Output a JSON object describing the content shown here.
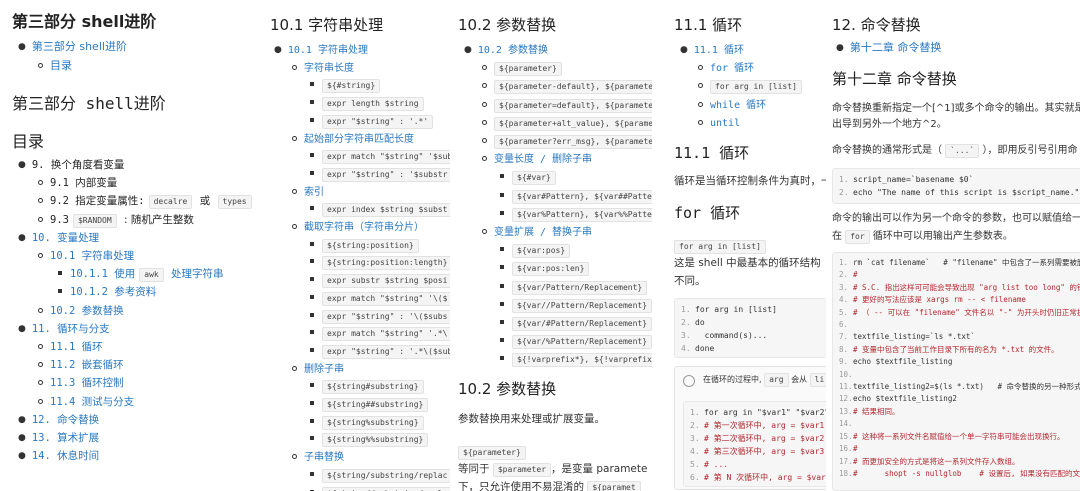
{
  "panel1": {
    "title": "第三部分 shell进阶",
    "toc1": "第三部分 shell进阶",
    "toc1_sub": "目录",
    "heading": "第三部分 shell进阶",
    "toc_title": "目录",
    "items": [
      {
        "t": "9. 换个角度看变量",
        "lv": 0,
        "link": false
      },
      {
        "t": "9.1 内部变量",
        "lv": 1,
        "link": false
      },
      {
        "t": "9.2 指定变量属性:",
        "lv": 1,
        "link": false,
        "codes": [
          "decalre",
          "或",
          "types"
        ]
      },
      {
        "t": "9.3",
        "lv": 1,
        "link": false,
        "codes": [
          "$RANDOM",
          ": 随机产生整数"
        ]
      },
      {
        "t": "10. 变量处理",
        "lv": 0,
        "link": true
      },
      {
        "t": "10.1 字符串处理",
        "lv": 1,
        "link": true
      },
      {
        "t": "10.1.1 使用",
        "lv": 2,
        "link": true,
        "codes": [
          "awk",
          "处理字符串"
        ]
      },
      {
        "t": "10.1.2 参考资料",
        "lv": 2,
        "link": true
      },
      {
        "t": "10.2 参数替换",
        "lv": 1,
        "link": true
      },
      {
        "t": "11. 循环与分支",
        "lv": 0,
        "link": true
      },
      {
        "t": "11.1 循环",
        "lv": 1,
        "link": true
      },
      {
        "t": "11.2 嵌套循环",
        "lv": 1,
        "link": true
      },
      {
        "t": "11.3 循环控制",
        "lv": 1,
        "link": true
      },
      {
        "t": "11.4 测试与分支",
        "lv": 1,
        "link": true
      },
      {
        "t": "12. 命令替换",
        "lv": 0,
        "link": true
      },
      {
        "t": "13. 算术扩展",
        "lv": 0,
        "link": true
      },
      {
        "t": "14. 休息时间",
        "lv": 0,
        "link": true
      }
    ]
  },
  "panel2": {
    "title": "10.1 字符串处理",
    "items": [
      {
        "t": "10.1 字符串处理",
        "lv": 0,
        "kind": "link"
      },
      {
        "t": "字符串长度",
        "lv": 1,
        "kind": "link"
      },
      {
        "t": "${#string}",
        "lv": 2,
        "kind": "code"
      },
      {
        "t": "expr length $string",
        "lv": 2,
        "kind": "code"
      },
      {
        "t": "expr \"$string\" : '.*'",
        "lv": 2,
        "kind": "code"
      },
      {
        "t": "起始部分字符串匹配长度",
        "lv": 1,
        "kind": "link"
      },
      {
        "t": "expr match \"$string\" '$sub",
        "lv": 2,
        "kind": "code"
      },
      {
        "t": "expr \"$string\" : '$substr",
        "lv": 2,
        "kind": "code"
      },
      {
        "t": "索引",
        "lv": 1,
        "kind": "link"
      },
      {
        "t": "expr index $string $subst",
        "lv": 2,
        "kind": "code"
      },
      {
        "t": "截取字符串（字符串分片）",
        "lv": 1,
        "kind": "link"
      },
      {
        "t": "${string:position}",
        "lv": 2,
        "kind": "code"
      },
      {
        "t": "${string:position:length}",
        "lv": 2,
        "kind": "code"
      },
      {
        "t": "expr substr $string $posi",
        "lv": 2,
        "kind": "code"
      },
      {
        "t": "expr match \"$string\" '\\($",
        "lv": 2,
        "kind": "code"
      },
      {
        "t": "expr \"$string\" : '\\($subs",
        "lv": 2,
        "kind": "code"
      },
      {
        "t": "expr match \"$string\" '.*\\",
        "lv": 2,
        "kind": "code"
      },
      {
        "t": "expr \"$string\" : '.*\\($sub",
        "lv": 2,
        "kind": "code"
      },
      {
        "t": "删除子串",
        "lv": 1,
        "kind": "link"
      },
      {
        "t": "${string#substring}",
        "lv": 2,
        "kind": "code"
      },
      {
        "t": "${string##substring}",
        "lv": 2,
        "kind": "code"
      },
      {
        "t": "${string%substring}",
        "lv": 2,
        "kind": "code"
      },
      {
        "t": "${string%%substring}",
        "lv": 2,
        "kind": "code"
      },
      {
        "t": "子串替换",
        "lv": 1,
        "kind": "link"
      },
      {
        "t": "${string/substring/replac",
        "lv": 2,
        "kind": "code"
      },
      {
        "t": "${string//substring/repla",
        "lv": 2,
        "kind": "code"
      }
    ]
  },
  "panel3": {
    "title": "10.2 参数替换",
    "items": [
      {
        "t": "10.2 参数替换",
        "lv": 0,
        "kind": "link"
      },
      {
        "t": "${parameter}",
        "lv": 1,
        "kind": "code"
      },
      {
        "t": "${parameter-default}, ${parameter",
        "lv": 1,
        "kind": "code"
      },
      {
        "t": "${parameter=default}, ${parameter",
        "lv": 1,
        "kind": "code"
      },
      {
        "t": "${parameter+alt_value}, ${paramet",
        "lv": 1,
        "kind": "code"
      },
      {
        "t": "${parameter?err_msg}, ${parameter",
        "lv": 1,
        "kind": "code"
      },
      {
        "t": "变量长度 / 删除子串",
        "lv": 1,
        "kind": "link"
      },
      {
        "t": "${#var}",
        "lv": 2,
        "kind": "code"
      },
      {
        "t": "${var#Pattern}, ${var##Patter",
        "lv": 2,
        "kind": "code"
      },
      {
        "t": "${var%Pattern}, ${var%%Patter",
        "lv": 2,
        "kind": "code"
      },
      {
        "t": "变量扩展 / 替换子串",
        "lv": 1,
        "kind": "link"
      },
      {
        "t": "${var:pos}",
        "lv": 2,
        "kind": "code"
      },
      {
        "t": "${var:pos:len}",
        "lv": 2,
        "kind": "code"
      },
      {
        "t": "${var/Pattern/Replacement}",
        "lv": 2,
        "kind": "code"
      },
      {
        "t": "${var//Pattern/Replacement}",
        "lv": 2,
        "kind": "code"
      },
      {
        "t": "${var/#Pattern/Replacement}",
        "lv": 2,
        "kind": "code"
      },
      {
        "t": "${var/%Pattern/Replacement}",
        "lv": 2,
        "kind": "code"
      },
      {
        "t": "${!varprefix*}, ${!varprefix",
        "lv": 2,
        "kind": "code"
      }
    ],
    "section": "10.2 参数替换",
    "para1": "参数替换用来处理或扩展变量。",
    "code1": "${parameter}",
    "para2a": "等同于",
    "para2code": "$parameter",
    "para2b": "，是变量 paramete",
    "para3a": "下，只允许使用不易混淆的",
    "para3code": "${paramet"
  },
  "panel4": {
    "title": "11.1 循环",
    "items": [
      {
        "t": "11.1 循环",
        "lv": 0,
        "kind": "link"
      },
      {
        "t": "for 循环",
        "lv": 1,
        "kind": "link"
      },
      {
        "t": "for arg in [list]",
        "lv": 1,
        "kind": "code"
      },
      {
        "t": "while 循环",
        "lv": 1,
        "kind": "link"
      },
      {
        "t": "until",
        "lv": 1,
        "kind": "link"
      }
    ],
    "section": "11.1 循环",
    "para1": "循环是当循环控制条件为真时，一",
    "sub": "for 循环",
    "code1": "for arg in [list]",
    "para2": "这是 shell 中最基本的循环结构",
    "para3": "不同。",
    "code_lines": [
      {
        "n": "1.",
        "t": "for arg in [list]"
      },
      {
        "n": "2.",
        "t": "do"
      },
      {
        "n": "3.",
        "t": "  command(s)..."
      },
      {
        "n": "4.",
        "t": "done"
      }
    ],
    "note_a": "在循环的过程中,",
    "note_code1": "arg",
    "note_b": "会从",
    "note_code2": "li",
    "code2_lines": [
      {
        "n": "1.",
        "t": "for arg in \"$var1\" \"$var2\" \""
      },
      {
        "n": "2.",
        "t": "# 第一次循环中, arg = $var1"
      },
      {
        "n": "3.",
        "t": "# 第二次循环中, arg = $var2"
      },
      {
        "n": "4.",
        "t": "# 第三次循环中, arg = $var3"
      },
      {
        "n": "5.",
        "t": "# ..."
      },
      {
        "n": "6.",
        "t": "# 第 N 次循环中, arg = $varN"
      }
    ]
  },
  "panel5": {
    "title": "12. 命令替换",
    "toc": "第十二章 命令替换",
    "heading": "第十二章  命令替换",
    "para1": "命令替换重新指定一个[^1]或多个命令的输出。其实就是",
    "para2": "出导到另外一个地方^2。",
    "para3a": "命令替换的通常形式是（",
    "para3code": "`...`",
    "para3b": "），即用反引号引用命",
    "code1_lines": [
      {
        "n": "1.",
        "t": "script_name=`basename $0`"
      },
      {
        "n": "2.",
        "t": "echo \"The name of this script is $script_name.\""
      }
    ],
    "para4": "命令的输出可以作为另一个命令的参数，也可以赋值给一",
    "para5a": "在",
    "para5code": "for",
    "para5b": "循环中可以用输出产生参数表。",
    "code2_lines": [
      {
        "n": "1.",
        "t": "rm `cat filename`   # \"filename\" 中包含了一系列需要被删除的"
      },
      {
        "n": "2.",
        "t": "#"
      },
      {
        "n": "3.",
        "t": "# S.C. 指出这样可可能会导致出现 \"arg list too long\" 的错误"
      },
      {
        "n": "4.",
        "t": "# 更好的写法应该是 xargs rm -- < filename"
      },
      {
        "n": "5.",
        "t": "# （ -- 可以在 \"filename\" 文件名以 \"-\" 为开头时仍旧正常执行"
      },
      {
        "n": "6.",
        "t": ""
      },
      {
        "n": "7.",
        "t": "textfile_listing=`ls *.txt`"
      },
      {
        "n": "8.",
        "t": "# 变量中包含了当前工作目录下所有的名为 *.txt 的文件。"
      },
      {
        "n": "9.",
        "t": "echo $textfile_listing"
      },
      {
        "n": "10.",
        "t": ""
      },
      {
        "n": "11.",
        "t": "textfile_listing2=$(ls *.txt)   # 命令替换的另一种形式。"
      },
      {
        "n": "12.",
        "t": "echo $textfile_listing2"
      },
      {
        "n": "13.",
        "t": "# 结果相同。"
      },
      {
        "n": "14.",
        "t": ""
      },
      {
        "n": "15.",
        "t": "# 这种将一系列文件名赋值给一个单一字符串可能会出现换行。"
      },
      {
        "n": "16.",
        "t": "#"
      },
      {
        "n": "17.",
        "t": "# 而更加安全的方式是将这一系列文件存入数组。"
      },
      {
        "n": "18.",
        "t": "#      shopt -s nullglob    # 设置后, 如果没有匹配的文件,"
      }
    ]
  }
}
